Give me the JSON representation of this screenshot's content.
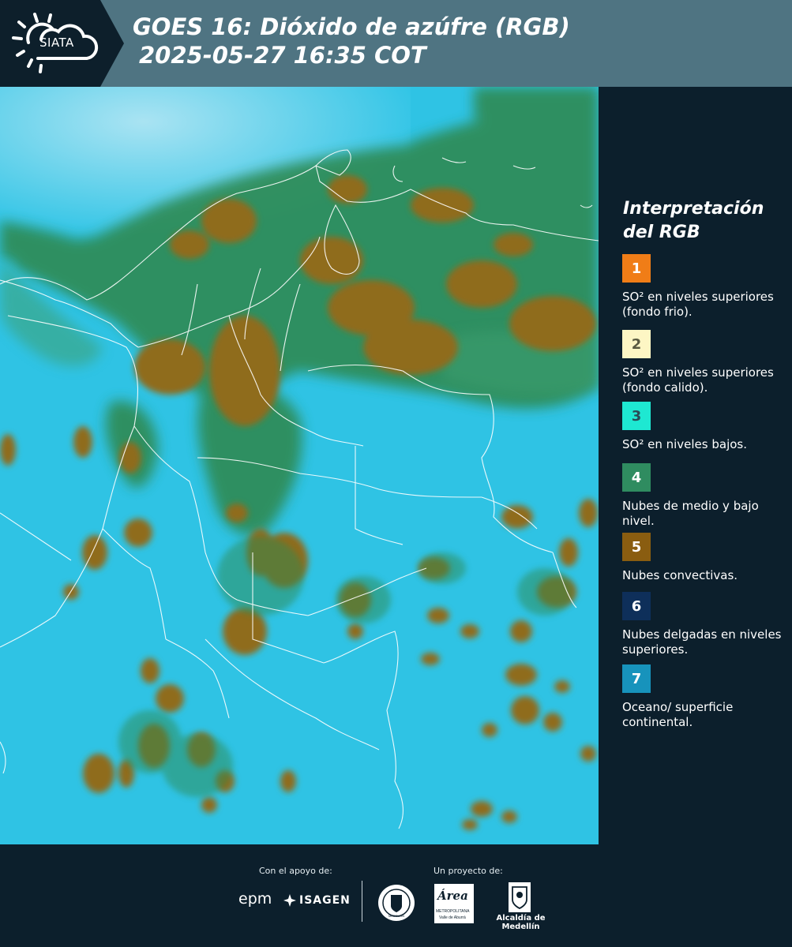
{
  "header": {
    "logo_text": "SIATA",
    "title_line1": "GOES 16: Dióxido de azúfre (RGB)",
    "title_line2": "2025-05-27 16:35 COT"
  },
  "legend": {
    "title_line1": "Interpretación",
    "title_line2": "del RGB",
    "items": [
      {
        "number": "1",
        "color": "#f07d17",
        "text_color": "#ffffff",
        "label": "SO² en niveles superiores (fondo frio)."
      },
      {
        "number": "2",
        "color": "#fdf6c4",
        "text_color": "#5a5a40",
        "label": "SO² en niveles superiores (fondo calido)."
      },
      {
        "number": "3",
        "color": "#1ee8d2",
        "text_color": "#2a4b55",
        "label": "SO² en niveles bajos."
      },
      {
        "number": "4",
        "color": "#2f8c60",
        "text_color": "#ffffff",
        "label": "Nubes de medio y bajo nivel."
      },
      {
        "number": "5",
        "color": "#8a5d10",
        "text_color": "#ffffff",
        "label": "Nubes convectivas."
      },
      {
        "number": "6",
        "color": "#0e2f5a",
        "text_color": "#ffffff",
        "label": "Nubes delgadas en niveles superiores."
      },
      {
        "number": "7",
        "color": "#1793bc",
        "text_color": "#ffffff",
        "label": "Oceano/ superficie continental."
      }
    ]
  },
  "footer": {
    "support_label": "Con el apoyo de:",
    "project_label": "Un proyecto de:",
    "sponsor1": "epm",
    "sponsor2": "ISAGEN",
    "partner1_text": "Área",
    "partner1_sub": "METROPOLITANA",
    "partner1_sub2": "Valle de Aburrá",
    "partner2": "Alcaldía de Medellín",
    "seal_text": "MEDELLÍN"
  },
  "colors": {
    "header_bg": "#4f7482",
    "panel_bg": "#0c1f2c",
    "ocean": "#2ec4e6",
    "cloud_green": "#2e8a55",
    "cloud_brown": "#8f6a1e"
  }
}
